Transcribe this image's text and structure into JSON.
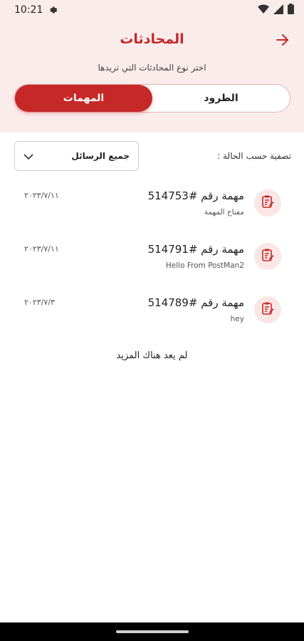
{
  "status_bar": {
    "time": "10:21",
    "icons": [
      "gear-icon",
      "wifi-icon",
      "signal-icon",
      "battery-icon"
    ]
  },
  "header": {
    "title": "المحادثات",
    "subtitle": "اختر نوع المحادثات التي تريدها",
    "back_icon": "arrow-right-icon",
    "background": "#fbecec",
    "accent": "#c62828"
  },
  "tabs": [
    {
      "label": "الطرود",
      "active": false
    },
    {
      "label": "المهمات",
      "active": true
    }
  ],
  "filter": {
    "label": "تصفية حسب الحالة :",
    "selected": "جميع الرسائل",
    "icon": "chevron-down-icon"
  },
  "tasks": [
    {
      "title": "مهمة رقم #514753",
      "subtitle": "مفتاح المهمة",
      "date": "٢٠٢٣/٧/١١",
      "icon": "clipboard-edit-icon"
    },
    {
      "title": "مهمة رقم #514791",
      "subtitle": "Hello From PostMan2",
      "date": "٢٠٢٣/٧/١١",
      "icon": "clipboard-edit-icon"
    },
    {
      "title": "مهمة رقم #514789",
      "subtitle": "hey",
      "date": "٢٠٢٣/٧/٣",
      "icon": "clipboard-edit-icon"
    }
  ],
  "footer": {
    "no_more": "لم يعد هناك المزيد"
  }
}
